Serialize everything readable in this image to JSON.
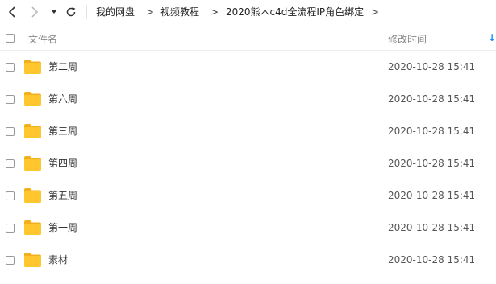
{
  "toolbar": {
    "breadcrumbs": [
      "我的网盘",
      "视频教程",
      "2020熊木c4d全流程IP角色绑定"
    ],
    "separator": ">"
  },
  "header": {
    "name_label": "文件名",
    "time_label": "修改时间",
    "sort_arrow": "↓"
  },
  "files": [
    {
      "name": "第二周",
      "modified": "2020-10-28 15:41",
      "icon": "folder-icon"
    },
    {
      "name": "第六周",
      "modified": "2020-10-28 15:41",
      "icon": "folder-icon"
    },
    {
      "name": "第三周",
      "modified": "2020-10-28 15:41",
      "icon": "folder-icon"
    },
    {
      "name": "第四周",
      "modified": "2020-10-28 15:41",
      "icon": "folder-icon"
    },
    {
      "name": "第五周",
      "modified": "2020-10-28 15:41",
      "icon": "folder-icon"
    },
    {
      "name": "第一周",
      "modified": "2020-10-28 15:41",
      "icon": "folder-icon"
    },
    {
      "name": "素材",
      "modified": "2020-10-28 15:41",
      "icon": "folder-icon"
    }
  ],
  "colors": {
    "folder": "#FFC62E",
    "folder_dark": "#F2B01E",
    "sort_accent": "#1A8CFF"
  }
}
